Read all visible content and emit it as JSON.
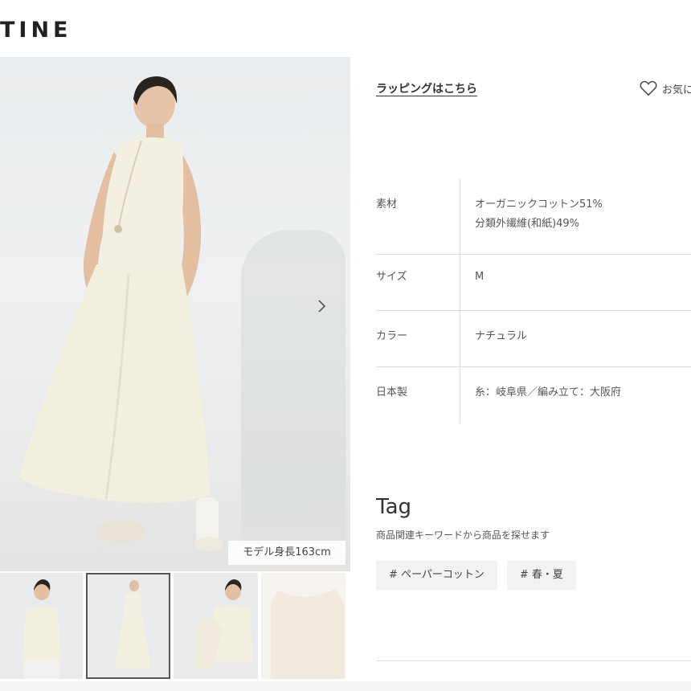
{
  "brand": {
    "logo_text": "TINE"
  },
  "gallery": {
    "model_height_label": "モデル身長163cm",
    "next_icon": "chevron-right-icon",
    "thumbnails": [
      "thumb-1",
      "thumb-2",
      "thumb-3",
      "thumb-4"
    ],
    "active_thumbnail": 1
  },
  "actions": {
    "wrapping_link": "ラッピングはこちら",
    "favorite_label": "お気に",
    "favorite_icon": "heart-icon"
  },
  "spec": [
    {
      "key": "素材",
      "value_lines": [
        "オーガニックコットン51%",
        "分類外繊維(和紙)49%"
      ]
    },
    {
      "key": "サイズ",
      "value_lines": [
        "M"
      ]
    },
    {
      "key": "カラー",
      "value_lines": [
        "ナチュラル"
      ]
    },
    {
      "key": "日本製",
      "value_lines": [
        "糸：岐阜県／編み立て：大阪府"
      ]
    }
  ],
  "tag_section": {
    "title": "Tag",
    "subtitle": "商品関連キーワードから商品を探せます",
    "tags": [
      "# ペーパーコットン",
      "# 春・夏"
    ]
  },
  "colors": {
    "garment": "#f3efe0",
    "background": "#ffffff",
    "text": "#333333"
  }
}
